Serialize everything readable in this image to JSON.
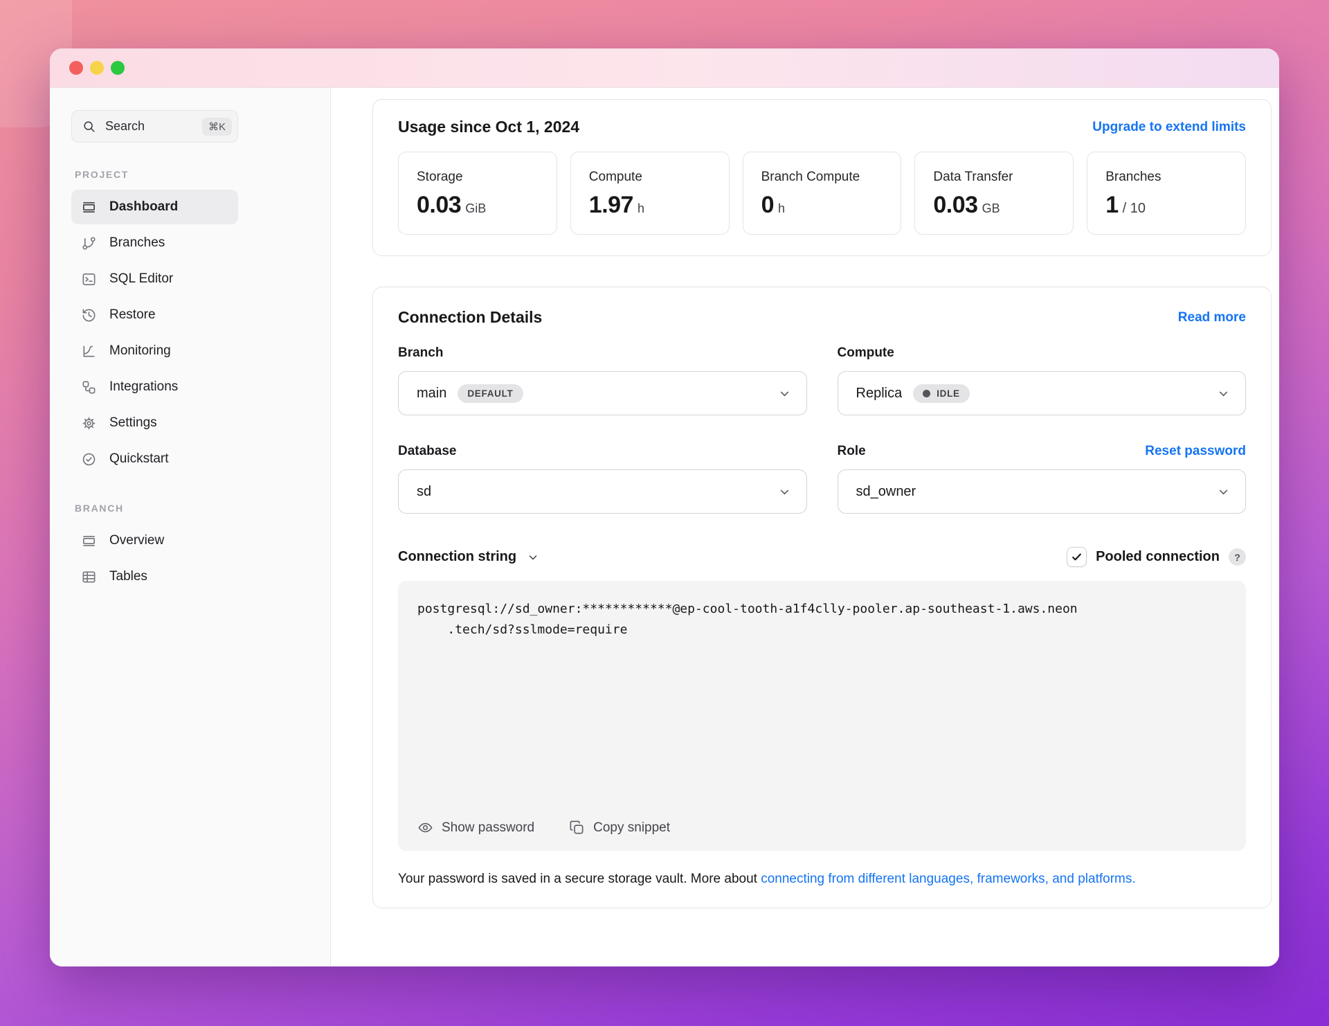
{
  "window": {
    "traffic_lights": [
      "close",
      "minimize",
      "maximize"
    ]
  },
  "sidebar": {
    "search": {
      "label": "Search",
      "shortcut": "⌘K"
    },
    "sections": [
      {
        "label": "PROJECT",
        "items": [
          {
            "icon": "dashboard-icon",
            "label": "Dashboard",
            "active": true
          },
          {
            "icon": "branches-icon",
            "label": "Branches",
            "active": false
          },
          {
            "icon": "sql-editor-icon",
            "label": "SQL Editor",
            "active": false
          },
          {
            "icon": "restore-icon",
            "label": "Restore",
            "active": false
          },
          {
            "icon": "monitoring-icon",
            "label": "Monitoring",
            "active": false
          },
          {
            "icon": "integrations-icon",
            "label": "Integrations",
            "active": false
          },
          {
            "icon": "settings-icon",
            "label": "Settings",
            "active": false
          },
          {
            "icon": "quickstart-icon",
            "label": "Quickstart",
            "active": false
          }
        ]
      },
      {
        "label": "BRANCH",
        "items": [
          {
            "icon": "overview-icon",
            "label": "Overview",
            "active": false
          },
          {
            "icon": "tables-icon",
            "label": "Tables",
            "active": false
          }
        ]
      }
    ]
  },
  "usage": {
    "title": "Usage since Oct 1, 2024",
    "upgrade_link": "Upgrade to extend limits",
    "stats": [
      {
        "label": "Storage",
        "value": "0.03",
        "unit": "GiB"
      },
      {
        "label": "Compute",
        "value": "1.97",
        "unit": "h"
      },
      {
        "label": "Branch Compute",
        "value": "0",
        "unit": "h"
      },
      {
        "label": "Data Transfer",
        "value": "0.03",
        "unit": "GB"
      },
      {
        "label": "Branches",
        "value": "1",
        "unit": "/ 10"
      }
    ]
  },
  "connection": {
    "title": "Connection Details",
    "read_more": "Read more",
    "fields": {
      "branch": {
        "label": "Branch",
        "value": "main",
        "badge": "DEFAULT"
      },
      "compute": {
        "label": "Compute",
        "value": "Replica",
        "badge": "IDLE"
      },
      "database": {
        "label": "Database",
        "value": "sd"
      },
      "role": {
        "label": "Role",
        "value": "sd_owner",
        "action": "Reset password"
      }
    },
    "string_selector": {
      "label": "Connection string"
    },
    "pooled": {
      "label": "Pooled connection",
      "help": "?",
      "checked": true
    },
    "connection_string": "postgresql://sd_owner:************@ep-cool-tooth-a1f4clly-pooler.ap-southeast-1.aws.neon\n    .tech/sd?sslmode=require",
    "actions": {
      "show_password": "Show password",
      "copy_snippet": "Copy snippet"
    },
    "footer": {
      "text": "Your password is saved in a secure storage vault. More about ",
      "link": "connecting from different languages, frameworks, and platforms."
    }
  },
  "colors": {
    "accent_blue": "#1574f2",
    "sidebar_bg": "#fafafa",
    "active_item_bg": "#ececee",
    "badge_bg": "#e4e4e7",
    "code_bg": "#f4f4f5",
    "card_border": "#e4e4e7",
    "gradient_top": "#f0919d",
    "gradient_bottom": "#8a2ed5",
    "titlebar_pink": "#fbdce4",
    "traffic_red": "#f2605d",
    "traffic_yellow": "#f6d44a",
    "traffic_green": "#2bc840"
  }
}
